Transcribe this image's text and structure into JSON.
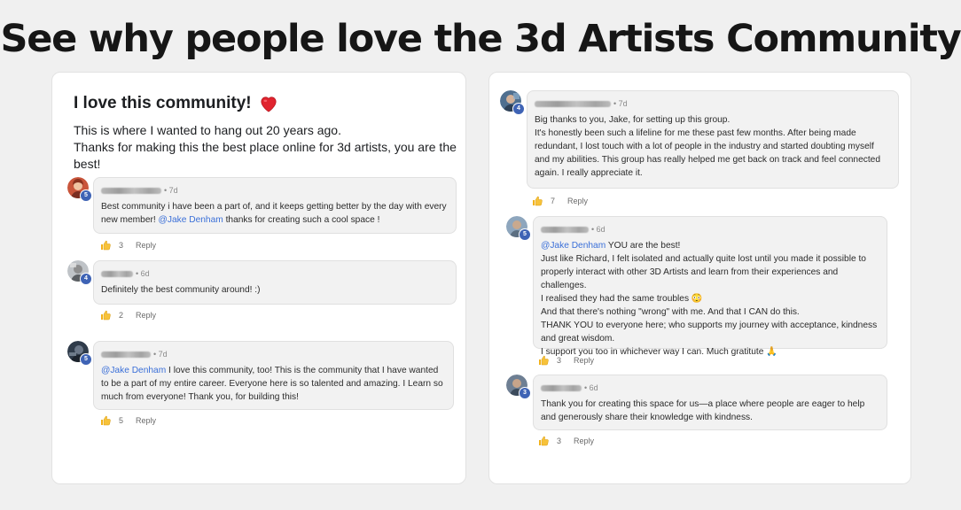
{
  "headline": "See why people love the 3d Artists Community",
  "post": {
    "title": "I love this community!",
    "lines": [
      "This is where I wanted to hang out 20 years ago.",
      "Thanks for making this the best place online for 3d artists, you are the best!"
    ]
  },
  "reply_label": "Reply",
  "left_comments": [
    {
      "level": "5",
      "time": "• 7d",
      "text_a": "Best community i have been a part of, and it keeps getting better by the day with every new member! ",
      "mention": "@Jake Denham",
      "text_b": " thanks for creating such a cool space !",
      "likes": "3"
    },
    {
      "level": "4",
      "time": "• 6d",
      "text": "Definitely the best community around! :)",
      "likes": "2"
    },
    {
      "level": "5",
      "time": "• 7d",
      "mention": "@Jake Denham",
      "text_b": " I love this community, too! This is the community that I have wanted to be a part of my entire career. Everyone here is so talented and amazing. I Learn so much from everyone! Thank you, for building this!",
      "likes": "5"
    }
  ],
  "right_comments": [
    {
      "level": "4",
      "time": "• 7d",
      "lines": [
        "Big thanks to you, Jake, for setting up this group.",
        "It's honestly been such a lifeline for me these past few months. After being made redundant, I lost touch with a lot of people in the industry and started doubting myself and my abilities. This group has really helped me get back on track and feel connected again. I really appreciate it."
      ],
      "likes": "7"
    },
    {
      "level": "5",
      "time": "• 6d",
      "mention": "@Jake Denham",
      "first_line_rest": " YOU are the best!",
      "lines": [
        "Just like Richard, I felt isolated and actually quite lost until you made it possible to properly interact with other 3D Artists and learn from their experiences and challenges.",
        "I realised they had the same troubles 😳",
        "And that there's nothing \"wrong\" with me. And that I CAN do this.",
        "THANK YOU to everyone here; who supports my journey with acceptance, kindness and great wisdom.",
        "I support you too in whichever way I can. Much gratitute 🙏"
      ],
      "likes": "3"
    },
    {
      "level": "3",
      "time": "• 6d",
      "text": "Thank you for creating this space for us—a place where people are eager to help and generously share their knowledge with kindness.",
      "likes": "3"
    }
  ],
  "colors": {
    "accent_badge": "#3e63b5",
    "mention": "#3a6fd8",
    "heart": "#e0242f",
    "thumb": "#f2b21b"
  },
  "icons": {
    "heart": "heart-icon",
    "like": "thumbs-up-icon"
  }
}
